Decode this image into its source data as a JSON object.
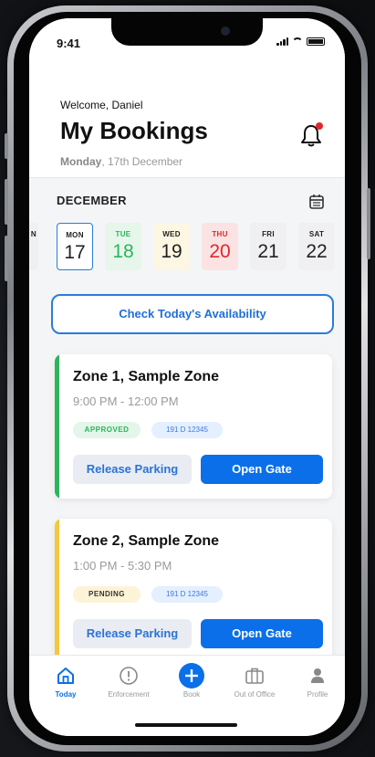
{
  "status_bar": {
    "time": "9:41"
  },
  "header": {
    "welcome": "Welcome, Daniel",
    "title": "My Bookings",
    "date_day": "Monday",
    "date_rest": ", 17th December"
  },
  "calendar": {
    "month": "DECEMBER",
    "days": [
      {
        "name": "N",
        "num": ""
      },
      {
        "name": "MON",
        "num": "17"
      },
      {
        "name": "TUE",
        "num": "18"
      },
      {
        "name": "WED",
        "num": "19"
      },
      {
        "name": "THU",
        "num": "20"
      },
      {
        "name": "FRI",
        "num": "21"
      },
      {
        "name": "SAT",
        "num": "22"
      }
    ]
  },
  "availability_button": "Check Today's Availability",
  "bookings": [
    {
      "zone": "Zone 1, Sample Zone",
      "time": "9:00 PM - 12:00 PM",
      "status": "APPROVED",
      "plate": "191 D 12345",
      "release_label": "Release Parking",
      "gate_label": "Open Gate",
      "accent": "#2bb55d"
    },
    {
      "zone": "Zone 2, Sample Zone",
      "time": "1:00 PM - 5:30 PM",
      "status": "PENDING",
      "plate": "191 D 12345",
      "release_label": "Release Parking",
      "gate_label": "Open Gate",
      "accent": "#f3c83c"
    }
  ],
  "tabs": [
    {
      "label": "Today",
      "icon": "home-icon"
    },
    {
      "label": "Enforcement",
      "icon": "alert-circle-icon"
    },
    {
      "label": "Book",
      "icon": "plus-circle-icon"
    },
    {
      "label": "Out of Office",
      "icon": "briefcase-icon"
    },
    {
      "label": "Profile",
      "icon": "person-icon"
    }
  ],
  "colors": {
    "primary": "#0a6fe8",
    "approved": "#2bb55d",
    "pending": "#f3c83c",
    "danger": "#e3262b"
  }
}
